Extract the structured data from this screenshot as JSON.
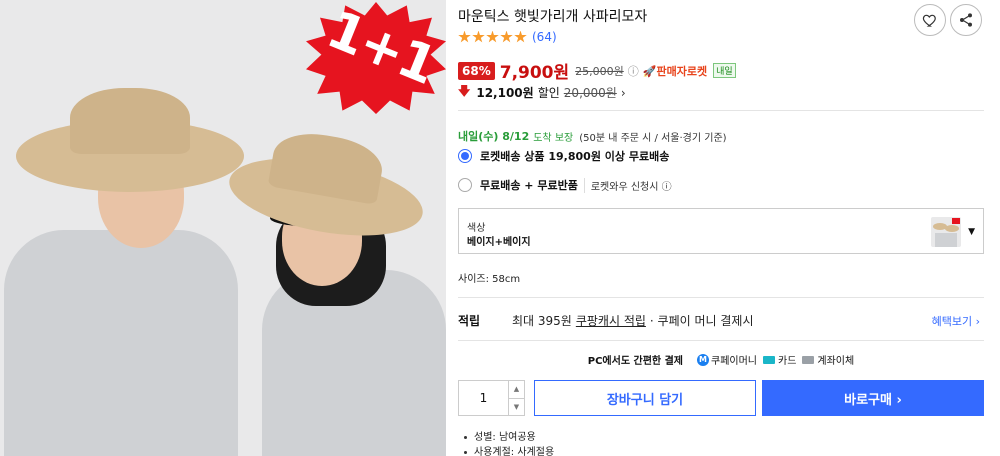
{
  "product": {
    "title": "마운틱스 햇빛가리개 사파리모자",
    "image_badge": "1+1",
    "review_count": "(64)",
    "rating_stars": 5
  },
  "price": {
    "discount_rate": "68%",
    "sale_price": "7,900원",
    "original_price": "25,000원",
    "info_icon": "ⓘ",
    "seller_badge": "🚀판매자로켓",
    "tomorrow_badge": "내일"
  },
  "coupon": {
    "arrow": "🡇",
    "amount": "12,100원",
    "label": "할인",
    "original": "20,000원",
    "chevron": "›"
  },
  "delivery": {
    "date": "내일(수) 8/12",
    "guarantee": "도착 보장",
    "note": "(50분 내 주문 시 / 서울·경기 기준)"
  },
  "shipping_options": [
    {
      "label": "로켓배송 상품 19,800원 이상 무료배송",
      "extra": "",
      "checked": true
    },
    {
      "label": "무료배송 + 무료반품",
      "extra": "로켓와우 신청시 ⓘ",
      "checked": false
    }
  ],
  "option": {
    "label": "색상",
    "value": "베이지+베이지",
    "caret": "▼"
  },
  "size_text": "사이즈: 58cm",
  "reward": {
    "label": "적립",
    "desc_prefix": "최대 395원",
    "link": "쿠팡캐시 적립",
    "desc_suffix": "· 쿠페이 머니 결제시",
    "benefit_link": "혜택보기 ›"
  },
  "payment": {
    "title": "PC에서도 간편한 결제",
    "methods": [
      {
        "icon": "coupay-icon",
        "glyph": "M",
        "label": "쿠페이머니"
      },
      {
        "icon": "card-icon",
        "label": "카드"
      },
      {
        "icon": "bank-icon",
        "label": "계좌이체"
      }
    ]
  },
  "purchase": {
    "quantity": "1",
    "up": "▲",
    "down": "▼",
    "cart_label": "장바구니 담기",
    "buy_label": "바로구매 ›"
  },
  "specs": [
    "성별: 남여공용",
    "사용계절: 사계절용"
  ],
  "icons": {
    "heart": "heart-icon",
    "share": "share-icon"
  },
  "colors": {
    "accent": "#346aff",
    "sale": "#c80f0f",
    "badge": "#d81d1d",
    "star": "#f89b2c",
    "delivery_green": "#2a9d3a"
  }
}
